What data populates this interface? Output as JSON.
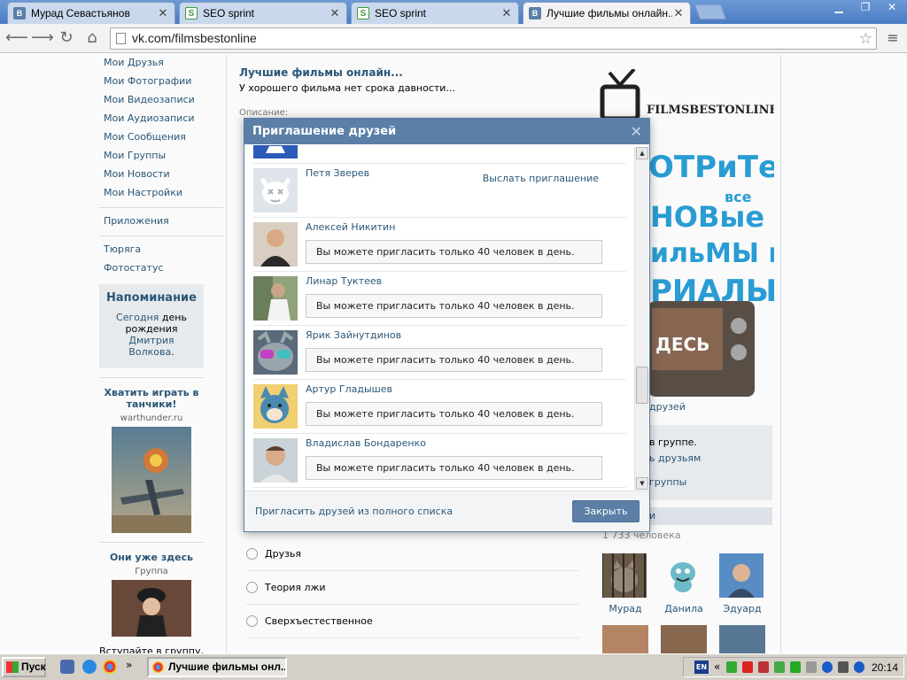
{
  "browser": {
    "tabs": [
      {
        "title": "Мурад Севастьянов",
        "favicon": "vk-favicon"
      },
      {
        "title": "SEO sprint",
        "favicon": "seosprint-favicon"
      },
      {
        "title": "SEO sprint",
        "favicon": "seosprint-favicon"
      },
      {
        "title": "Лучшие фильмы онлайн...",
        "favicon": "vk-favicon",
        "active": true
      }
    ],
    "url": "vk.com/filmsbestonline"
  },
  "left_menu": {
    "items": [
      "Мои Друзья",
      "Мои Фотографии",
      "Мои Видеозаписи",
      "Мои Аудиозаписи",
      "Мои Сообщения",
      "Мои Группы",
      "Мои Новости",
      "Мои Настройки"
    ],
    "apps": "Приложения",
    "extra": [
      "Тюряга",
      "Фотостатус"
    ],
    "reminder": {
      "title": "Напоминание",
      "today": "Сегодня",
      "text": "день рождения",
      "person": "Дмитрия Волкова"
    },
    "ad1": {
      "title": "Хватить играть в танчики!",
      "domain": "warthunder.ru"
    },
    "ad2": {
      "title": "Они уже здесь",
      "sub": "Группа",
      "text": "Вступайте в группу, докажите свою"
    }
  },
  "group": {
    "title": "Лучшие фильмы онлайн...",
    "status": "У хорошего фильма нет срока давности...",
    "desc_label": "Описание:",
    "poll_options": [
      "Друзья",
      "Теория лжи",
      "Сверхъестественное"
    ]
  },
  "right": {
    "poster_brand": "FILMSBESTONLINE",
    "poster_lines": [
      "ОТРиТе",
      "НОВые",
      "ильМЫ и",
      "РИАЛЫ"
    ],
    "poster_word": "ДЕСЬ",
    "poster_small": "все",
    "friends_link": "друзей",
    "in_group": "в группе.",
    "tell_friends": "ь друзьям",
    "groups_link": "группы",
    "members_head": "и",
    "members_count": "1 733 человека",
    "members": [
      "Мурад",
      "Данила",
      "Эдуард"
    ]
  },
  "modal": {
    "title": "Приглашение друзей",
    "invite_label": "Выслать приглашение",
    "limit_text": "Вы можете пригласить только 40 человек в день.",
    "friends": [
      {
        "name": "Петя Зверев",
        "state": "invite"
      },
      {
        "name": "Алексей Никитин",
        "state": "limit"
      },
      {
        "name": "Линар Туктеев",
        "state": "limit"
      },
      {
        "name": "Ярик Зайнутдинов",
        "state": "limit"
      },
      {
        "name": "Артур Гладышев",
        "state": "limit"
      },
      {
        "name": "Владислав Бондаренко",
        "state": "limit"
      }
    ],
    "footer_link": "Пригласить друзей из полного списка",
    "close_button": "Закрыть"
  },
  "taskbar": {
    "start": "Пуск",
    "window": "Лучшие фильмы онл...",
    "lang": "EN",
    "clock": "20:14"
  },
  "colors": {
    "vk_blue": "#5b7fa6",
    "link": "#2b587a"
  }
}
